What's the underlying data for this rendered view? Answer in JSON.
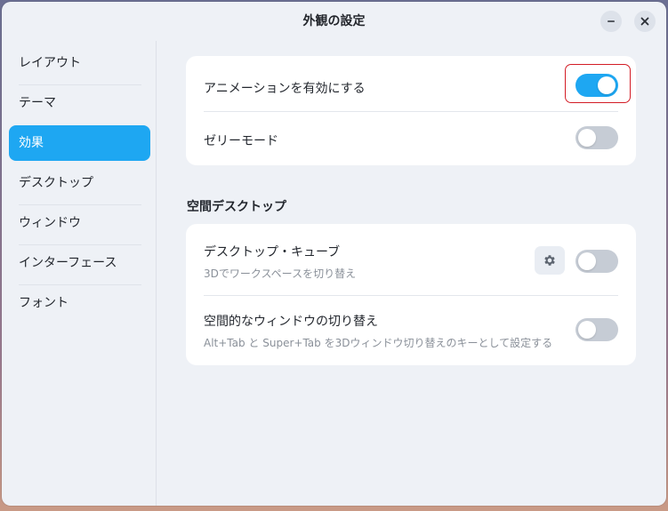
{
  "window": {
    "title": "外観の設定"
  },
  "sidebar": {
    "items": [
      {
        "label": "レイアウト",
        "active": false
      },
      {
        "label": "テーマ",
        "active": false
      },
      {
        "label": "効果",
        "active": true
      },
      {
        "label": "デスクトップ",
        "active": false
      },
      {
        "label": "ウィンドウ",
        "active": false
      },
      {
        "label": "インターフェース",
        "active": false
      },
      {
        "label": "フォント",
        "active": false
      }
    ]
  },
  "effects": {
    "animation": {
      "label": "アニメーションを有効にする",
      "enabled": true
    },
    "wobbly": {
      "label": "ゼリーモード",
      "enabled": false
    }
  },
  "spatial_desktop": {
    "section_title": "空間デスクトップ",
    "cube": {
      "label": "デスクトップ・キューブ",
      "description": "3Dでワークスペースを切り替え",
      "enabled": false
    },
    "window_switch": {
      "label": "空間的なウィンドウの切り替え",
      "description": "Alt+Tab と Super+Tab を3Dウィンドウ切り替えのキーとして設定する",
      "enabled": false
    }
  },
  "icons": {
    "minimize": "minimize-icon",
    "close": "close-icon",
    "settings": "gear-icon"
  },
  "colors": {
    "accent": "#1ea7f2",
    "highlight": "#d31c25",
    "window_bg": "#eef1f6",
    "card_bg": "#ffffff"
  }
}
